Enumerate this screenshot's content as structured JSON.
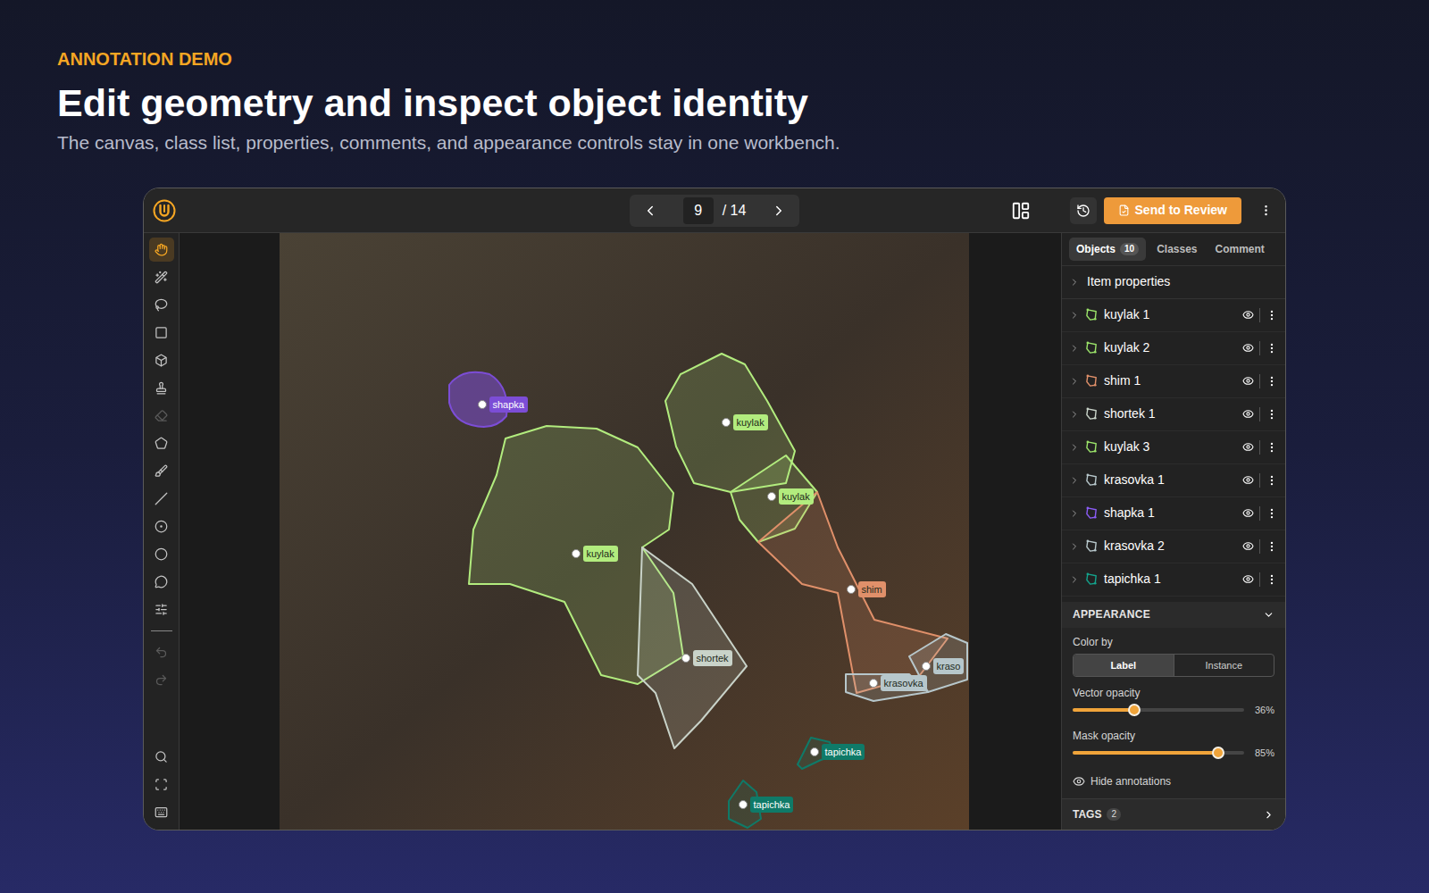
{
  "header": {
    "eyebrow": "ANNOTATION DEMO",
    "title": "Edit geometry and inspect object identity",
    "subtitle": "The canvas, class list, properties, comments, and appearance controls stay in one workbench."
  },
  "topbar": {
    "page": "9",
    "total": "/ 14",
    "send": "Send to Review"
  },
  "tools": [
    {
      "selected": true,
      "disabled": false
    },
    {
      "selected": false,
      "disabled": false
    },
    {
      "selected": false,
      "disabled": false
    },
    {
      "selected": false,
      "disabled": false
    },
    {
      "selected": false,
      "disabled": false
    },
    {
      "selected": false,
      "disabled": false
    },
    {
      "selected": false,
      "disabled": true
    },
    {
      "selected": false,
      "disabled": false
    },
    {
      "selected": false,
      "disabled": false
    },
    {
      "selected": false,
      "disabled": false
    },
    {
      "selected": false,
      "disabled": false
    },
    {
      "selected": false,
      "disabled": false
    },
    {
      "selected": false,
      "disabled": false
    },
    {
      "selected": false,
      "disabled": false
    }
  ],
  "history_tools": [
    {
      "selected": false,
      "disabled": true
    },
    {
      "selected": false,
      "disabled": true
    }
  ],
  "view_tools": [
    {
      "selected": false,
      "disabled": false
    },
    {
      "selected": false,
      "disabled": false
    },
    {
      "selected": false,
      "disabled": false
    }
  ],
  "annotations": [
    {
      "label": "shapka",
      "color": "#7c4dd6"
    },
    {
      "label": "kuylak",
      "color": "#b2ec7e"
    },
    {
      "label": "kuylak",
      "color": "#b2ec7e"
    },
    {
      "label": "kuylak",
      "color": "#b2ec7e"
    },
    {
      "label": "shortek",
      "color": "#c9d3c9"
    },
    {
      "label": "shim",
      "color": "#e0906a"
    },
    {
      "label": "krasovka",
      "color": "#b7c7cb"
    },
    {
      "label": "kraso",
      "color": "#b7c7cb"
    },
    {
      "label": "tapichka",
      "color": "#0f7a68"
    },
    {
      "label": "tapichka",
      "color": "#0f7a68"
    }
  ],
  "tabs": [
    {
      "label": "Objects",
      "badge": "10",
      "selected": true
    },
    {
      "label": "Classes",
      "selected": false
    },
    {
      "label": "Comment",
      "selected": false
    }
  ],
  "item_properties": "Item properties",
  "objects": [
    {
      "name": "kuylak 1",
      "color": "#9be36a"
    },
    {
      "name": "kuylak 2",
      "color": "#9be36a"
    },
    {
      "name": "shim 1",
      "color": "#e0906a"
    },
    {
      "name": "shortek 1",
      "color": "#c9d3c9"
    },
    {
      "name": "kuylak 3",
      "color": "#9be36a"
    },
    {
      "name": "krasovka 1",
      "color": "#b7c7cb"
    },
    {
      "name": "shapka 1",
      "color": "#8b5cf6"
    },
    {
      "name": "krasovka 2",
      "color": "#b7c7cb"
    },
    {
      "name": "tapichka 1",
      "color": "#14a38c"
    }
  ],
  "appearance": {
    "title": "APPEARANCE",
    "expanded": true,
    "color_by": {
      "label": "Color by",
      "options": [
        {
          "label": "Label",
          "selected": true
        },
        {
          "label": "Instance",
          "selected": false
        }
      ]
    },
    "sliders": [
      {
        "label": "Vector opacity",
        "level": 0.36,
        "reading": "36%"
      },
      {
        "label": "Mask opacity",
        "level": 0.85,
        "reading": "85%"
      }
    ],
    "hide": "Hide annotations"
  },
  "tags": {
    "title": "TAGS",
    "count": "2"
  }
}
